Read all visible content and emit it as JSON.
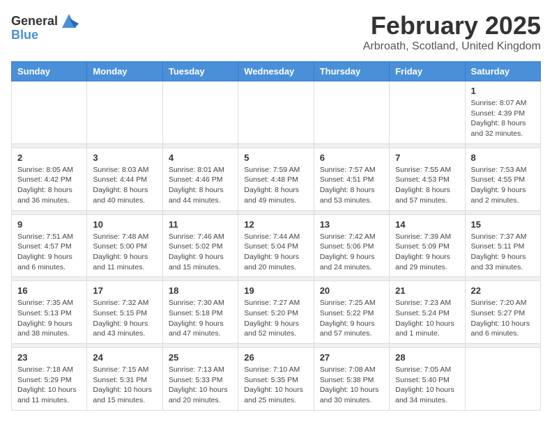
{
  "logo": {
    "text_general": "General",
    "text_blue": "Blue"
  },
  "header": {
    "title": "February 2025",
    "subtitle": "Arbroath, Scotland, United Kingdom"
  },
  "days_of_week": [
    "Sunday",
    "Monday",
    "Tuesday",
    "Wednesday",
    "Thursday",
    "Friday",
    "Saturday"
  ],
  "weeks": [
    [
      {
        "day": "",
        "info": ""
      },
      {
        "day": "",
        "info": ""
      },
      {
        "day": "",
        "info": ""
      },
      {
        "day": "",
        "info": ""
      },
      {
        "day": "",
        "info": ""
      },
      {
        "day": "",
        "info": ""
      },
      {
        "day": "1",
        "info": "Sunrise: 8:07 AM\nSunset: 4:39 PM\nDaylight: 8 hours and 32 minutes."
      }
    ],
    [
      {
        "day": "2",
        "info": "Sunrise: 8:05 AM\nSunset: 4:42 PM\nDaylight: 8 hours and 36 minutes."
      },
      {
        "day": "3",
        "info": "Sunrise: 8:03 AM\nSunset: 4:44 PM\nDaylight: 8 hours and 40 minutes."
      },
      {
        "day": "4",
        "info": "Sunrise: 8:01 AM\nSunset: 4:46 PM\nDaylight: 8 hours and 44 minutes."
      },
      {
        "day": "5",
        "info": "Sunrise: 7:59 AM\nSunset: 4:48 PM\nDaylight: 8 hours and 49 minutes."
      },
      {
        "day": "6",
        "info": "Sunrise: 7:57 AM\nSunset: 4:51 PM\nDaylight: 8 hours and 53 minutes."
      },
      {
        "day": "7",
        "info": "Sunrise: 7:55 AM\nSunset: 4:53 PM\nDaylight: 8 hours and 57 minutes."
      },
      {
        "day": "8",
        "info": "Sunrise: 7:53 AM\nSunset: 4:55 PM\nDaylight: 9 hours and 2 minutes."
      }
    ],
    [
      {
        "day": "9",
        "info": "Sunrise: 7:51 AM\nSunset: 4:57 PM\nDaylight: 9 hours and 6 minutes."
      },
      {
        "day": "10",
        "info": "Sunrise: 7:48 AM\nSunset: 5:00 PM\nDaylight: 9 hours and 11 minutes."
      },
      {
        "day": "11",
        "info": "Sunrise: 7:46 AM\nSunset: 5:02 PM\nDaylight: 9 hours and 15 minutes."
      },
      {
        "day": "12",
        "info": "Sunrise: 7:44 AM\nSunset: 5:04 PM\nDaylight: 9 hours and 20 minutes."
      },
      {
        "day": "13",
        "info": "Sunrise: 7:42 AM\nSunset: 5:06 PM\nDaylight: 9 hours and 24 minutes."
      },
      {
        "day": "14",
        "info": "Sunrise: 7:39 AM\nSunset: 5:09 PM\nDaylight: 9 hours and 29 minutes."
      },
      {
        "day": "15",
        "info": "Sunrise: 7:37 AM\nSunset: 5:11 PM\nDaylight: 9 hours and 33 minutes."
      }
    ],
    [
      {
        "day": "16",
        "info": "Sunrise: 7:35 AM\nSunset: 5:13 PM\nDaylight: 9 hours and 38 minutes."
      },
      {
        "day": "17",
        "info": "Sunrise: 7:32 AM\nSunset: 5:15 PM\nDaylight: 9 hours and 43 minutes."
      },
      {
        "day": "18",
        "info": "Sunrise: 7:30 AM\nSunset: 5:18 PM\nDaylight: 9 hours and 47 minutes."
      },
      {
        "day": "19",
        "info": "Sunrise: 7:27 AM\nSunset: 5:20 PM\nDaylight: 9 hours and 52 minutes."
      },
      {
        "day": "20",
        "info": "Sunrise: 7:25 AM\nSunset: 5:22 PM\nDaylight: 9 hours and 57 minutes."
      },
      {
        "day": "21",
        "info": "Sunrise: 7:23 AM\nSunset: 5:24 PM\nDaylight: 10 hours and 1 minute."
      },
      {
        "day": "22",
        "info": "Sunrise: 7:20 AM\nSunset: 5:27 PM\nDaylight: 10 hours and 6 minutes."
      }
    ],
    [
      {
        "day": "23",
        "info": "Sunrise: 7:18 AM\nSunset: 5:29 PM\nDaylight: 10 hours and 11 minutes."
      },
      {
        "day": "24",
        "info": "Sunrise: 7:15 AM\nSunset: 5:31 PM\nDaylight: 10 hours and 15 minutes."
      },
      {
        "day": "25",
        "info": "Sunrise: 7:13 AM\nSunset: 5:33 PM\nDaylight: 10 hours and 20 minutes."
      },
      {
        "day": "26",
        "info": "Sunrise: 7:10 AM\nSunset: 5:35 PM\nDaylight: 10 hours and 25 minutes."
      },
      {
        "day": "27",
        "info": "Sunrise: 7:08 AM\nSunset: 5:38 PM\nDaylight: 10 hours and 30 minutes."
      },
      {
        "day": "28",
        "info": "Sunrise: 7:05 AM\nSunset: 5:40 PM\nDaylight: 10 hours and 34 minutes."
      },
      {
        "day": "",
        "info": ""
      }
    ]
  ]
}
